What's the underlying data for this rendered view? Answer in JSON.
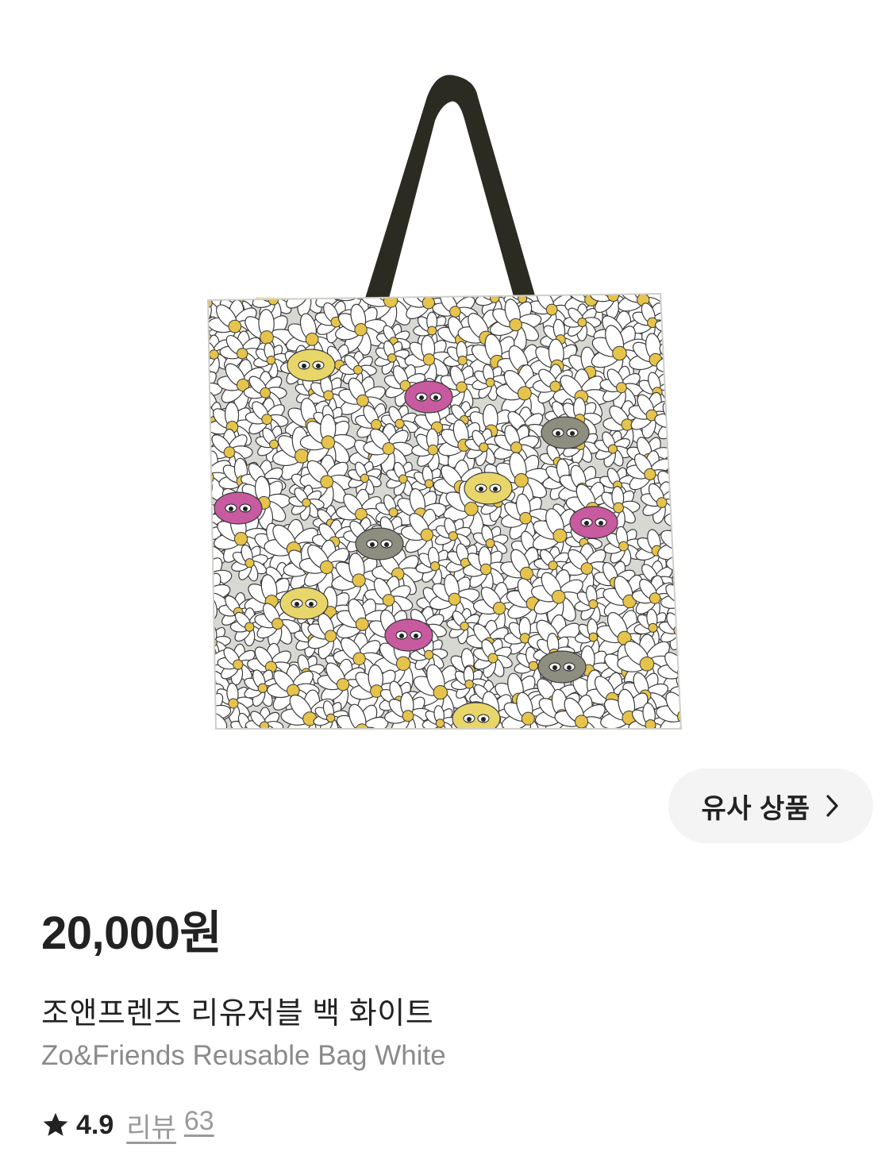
{
  "product": {
    "image_icon": "tote-bag-image",
    "price": "20,000원",
    "name_ko": "조앤프렌즈 리유저블 백 화이트",
    "name_en": "Zo&Friends Reusable Bag White",
    "rating": "4.9",
    "review_label": "리뷰",
    "review_count": "63"
  },
  "similar_button": {
    "label": "유사 상품",
    "icon": "chevron-right-icon"
  },
  "colors": {
    "text_primary": "#222222",
    "text_secondary": "#8a8a8a",
    "pill_bg": "#f4f4f4",
    "bag_handle": "#2b2b22",
    "petal": "#ffffff",
    "flower_center": "#e6c34a",
    "character_yellow": "#e8d66a",
    "character_pink": "#c85aa0",
    "character_gray": "#8d8d80"
  }
}
